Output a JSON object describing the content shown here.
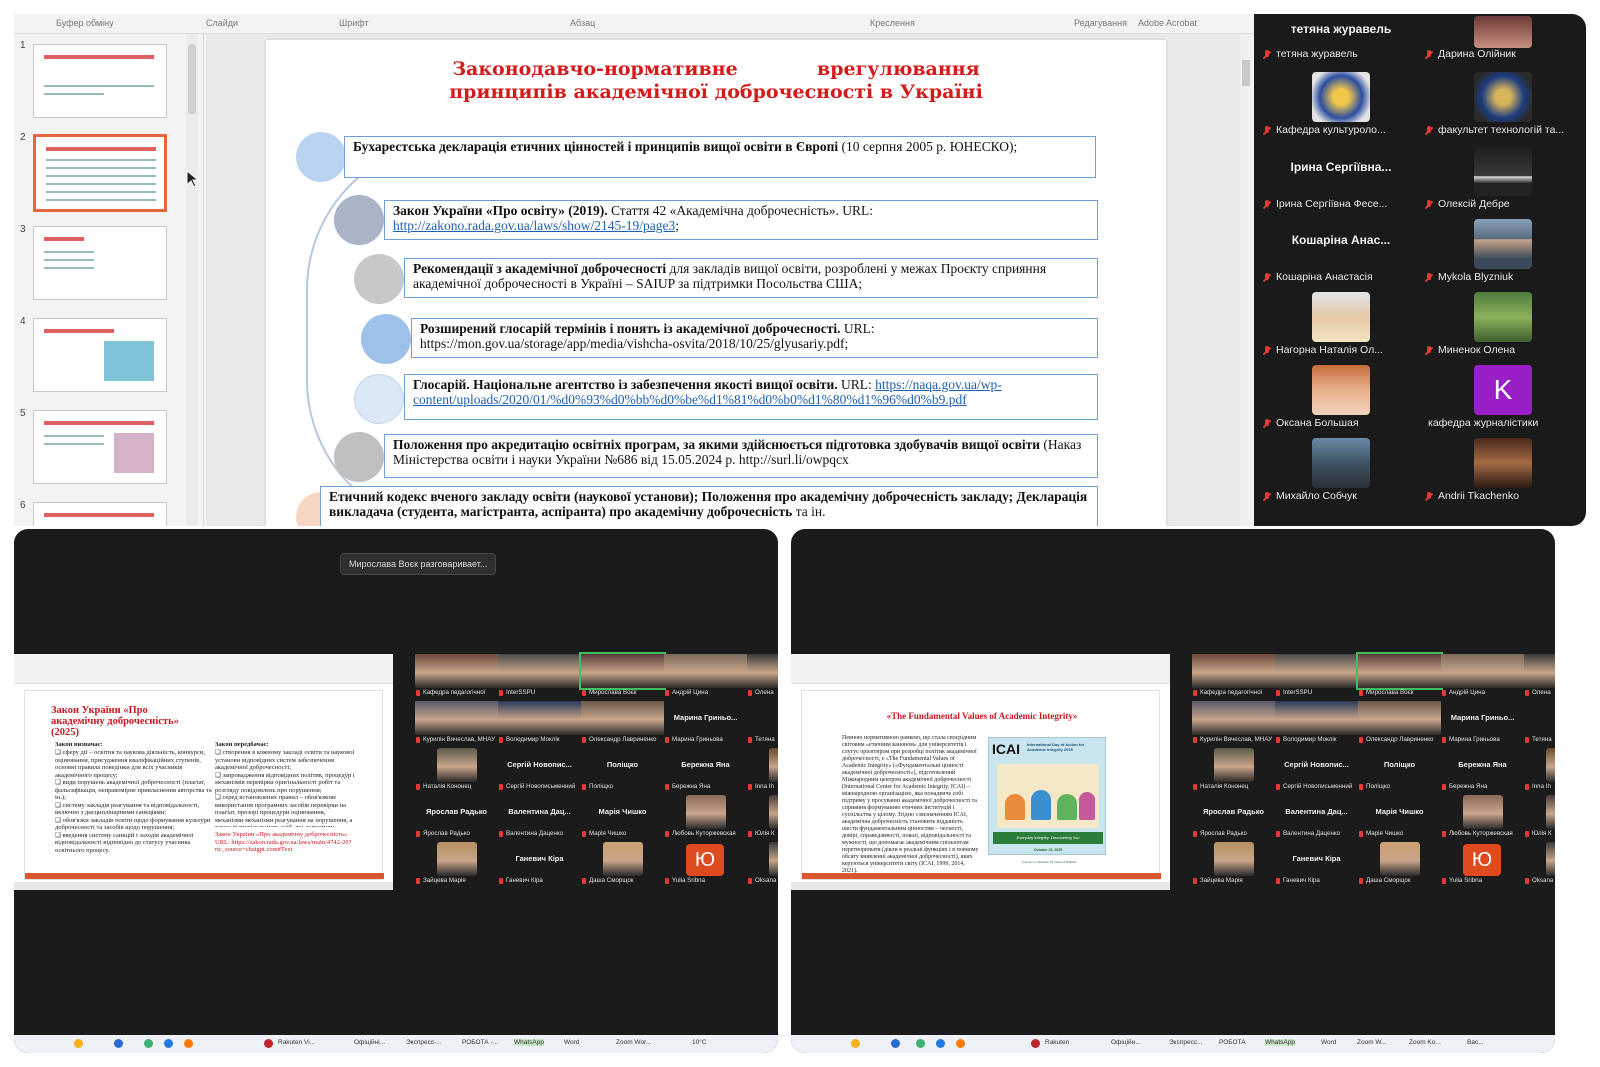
{
  "top": {
    "ribbon": [
      "Буфер обміну",
      "Слайди",
      "Шрифт",
      "Абзац",
      "Креслення",
      "Редагування",
      "Adobe Acrobat"
    ],
    "thumbnails": [
      "1",
      "2",
      "3",
      "4",
      "5",
      "6"
    ],
    "slide": {
      "title_line1": "Законодавчо-нормативне            врегулювання",
      "title_line2": "принципів академічної доброчесності в Україні",
      "items": [
        {
          "bold": "Бухарестська декларація етичних цінностей і принципів вищої освіти в Європі",
          "text": " (10 серпня 2005 р. ЮНЕСКО);",
          "url": ""
        },
        {
          "bold": "Закон України «Про освіту» (2019).",
          "text": " Стаття 42 «Академічна доброчесність». URL: ",
          "url": "http://zakono.rada.gov.ua/laws/show/2145-19/page3",
          "tail": ";"
        },
        {
          "bold": "Рекомендації з академічної доброчесності",
          "text": " для закладів вищої освіти, розроблені у межах Проєкту сприяння академічної доброчесності в Україні – SAIUP за підтримки Посольства США;",
          "url": ""
        },
        {
          "bold": "Розширений глосарій термінів і понять із академічної доброчесності.",
          "text": " URL: https://mon.gov.ua/storage/app/media/vishcha-osvita/2018/10/25/glyusariy.pdf;",
          "url": ""
        },
        {
          "bold": "Глосарій. Національне агентство із забезпечення якості вищої освіти.",
          "text": " URL: ",
          "url": "https://naqa.gov.ua/wp-content/uploads/2020/01/%d0%93%d0%bb%d0%be%d1%81%d0%b0%d1%80%d1%96%d0%b9.pdf"
        },
        {
          "bold": "Положення про акредитацію освітніх програм, за якими здійснюється підготовка здобувачів вищої освіти",
          "text": " (Наказ Міністерства освіти і науки України №686 від 15.05.2024 р. http://surl.li/owpqcx",
          "url": ""
        },
        {
          "bold": "Етичний кодекс вченого закладу освіти (наукової установи); Положення про академічну доброчесність закладу; Декларація викладача (студента, магістранта, аспіранта) про академічну доброчесність",
          "text": " та ін.",
          "url": ""
        }
      ]
    },
    "gallery": [
      {
        "big": "тетяна журавель",
        "name": "тетяна журавель"
      },
      {
        "big": "",
        "name": "Дарина Олійник"
      },
      {
        "big": "",
        "name": "Кафедра культуроло..."
      },
      {
        "big": "",
        "name": "факультет технологій та..."
      },
      {
        "big": "Ірина Сергіївна...",
        "name": "Ірина Сергіївна Фесе..."
      },
      {
        "big": "",
        "name": "Олексій Дебре"
      },
      {
        "big": "Кошаріна Анас...",
        "name": "Кошаріна Анастасія"
      },
      {
        "big": "",
        "name": "Mykola Blyzniuk"
      },
      {
        "big": "",
        "name": "Нагорна Наталія Ол..."
      },
      {
        "big": "",
        "name": "Миненок Олена"
      },
      {
        "big": "",
        "name": "Оксана Большая"
      },
      {
        "big": "K",
        "name": "кафедра журналістики"
      },
      {
        "big": "",
        "name": "Михайло Собчук"
      },
      {
        "big": "",
        "name": "Andrii Tkachenko"
      }
    ]
  },
  "bottom_left": {
    "tooltip": "Мирослава Воєк разговаривает...",
    "slide": {
      "title": "Закон України «Про академічну доброчесність» (2025)",
      "col1_head": "Закон визначає:",
      "col1": "❑ сферу дії – освітня та наукова діяльність, конкурси, оцінювання, присудження кваліфікаційних ступенів, основні правила поведінки для всіх учасників академічного процесу;\n❑ види порушень академічної доброчесності (плагіат, фальсифікація, неправомірне привласнення авторства та ін.);\n❑ систему закладів реагування та відповідальності, включно з дисциплінарними санкціями;\n❑ обов'язки закладів освіти щодо формування культури доброчесності та засобів щодо порушення;\n❑ введення систему санкцій і заходів академічної відповідальності відповідно до статусу учасника освітнього процесу.",
      "col2_head": "Закон передбачає:",
      "col2": "❑ створення в кожному закладі освіти та наукової установи відповідних систем забезпечення академічної доброчесності;\n❑ запровадження відповідних політик, процедур і механізмів перевірки оригінальності робіт та розгляду повідомлень про порушення;\n❑ серед встановлених правил – обов'язкове використання програмних засобів перевірки на плагіат, прозорі процедури оцінювання, механізми механізми реагування на порушення, а також відповідальність осіб, які допустили порушення академічної доброчесності.",
      "link": "Закон України «Про академічну доброчесність» URL: https://zakon.rada.gov.ua/laws/main/4742-20?rtc_source=chatgpt.com#Text"
    }
  },
  "bottom_right": {
    "slide": {
      "title": "«The Fundamental Values of Academic Integrity»",
      "body": "Певною нормативною рамкою, що стала своєрідним світовим «етичним каноном» для університетів і слугує орієнтиром при розробці політик академічної доброчесності, є «The Fundamental Values of Academic Integrity» («Фундаментальні цінності академічної доброчесності»), підготовлений Міжнародним центром академічної доброчесності (International Center for Academic Integrity, ICAI) – міжнародною організацією, яка понадвиче собі підтриму у просуванні академічної доброчесності та сприяння формуванню етичних інституцій і суспільства у цілому. Згідно з визначенням ICAI, академічна доброчесність становить відданість шести фундаментальним цінностям – чесності, довірі, справедливості, повазі, відповідальності та мужності, що допомагає академічним спільнотам перетворювати (діяли в реальні функціях і в повному обсягу виявленні академічної доброчесності), яких керуються університети світу (ICAI, 1999, 2014, 2021).",
      "icai_logo": "ICAI",
      "icai_head": "International Day of Action for Academic Integrity 2025",
      "icai_foot": "Everyday Integrity: Discovering You",
      "icai_date": "October 15, 2025",
      "icai_foot2": "Join us to celebrate 25 years of IDOAI"
    }
  },
  "bottom_gallery": [
    {
      "big": "",
      "name": "Кафедра педагогічної"
    },
    {
      "big": "",
      "name": "InterSSPU"
    },
    {
      "big": "",
      "name": "Мирослава Воєк"
    },
    {
      "big": "",
      "name": "Андрій Цина"
    },
    {
      "big": "",
      "name": "Олена"
    },
    {
      "big": "",
      "name": "Курилін Вячеслав, МНАУ"
    },
    {
      "big": "",
      "name": "Володимир Моклік"
    },
    {
      "big": "",
      "name": "Олександр Лавриненко"
    },
    {
      "big": "Марина Гриньо...",
      "name": "Марина Гриньова"
    },
    {
      "big": "Тетян",
      "name": "Тетяна"
    },
    {
      "big": "",
      "name": "Наталія Кононец"
    },
    {
      "big": "Сергій Новопис...",
      "name": "Сергій Новописьменний"
    },
    {
      "big": "Поліщко",
      "name": "Поліщко"
    },
    {
      "big": "Бережна Яна",
      "name": "Бережна Яна"
    },
    {
      "big": "",
      "name": "Inna Ih"
    },
    {
      "big": "Ярослав Радько",
      "name": "Ярослав Радько"
    },
    {
      "big": "Валентина Дац...",
      "name": "Валентина Даценко"
    },
    {
      "big": "Марія Чишко",
      "name": "Марія Чишко"
    },
    {
      "big": "",
      "name": "Любовь Куторжевская"
    },
    {
      "big": "",
      "name": "Юлія К"
    },
    {
      "big": "",
      "name": "Зайцева Марія"
    },
    {
      "big": "Ганевич Кіра",
      "name": "Ганевич Кіра"
    },
    {
      "big": "",
      "name": "Даша Сморщок"
    },
    {
      "big": "Ю",
      "name": "Yulia Sribna"
    },
    {
      "big": "",
      "name": "Oksana"
    }
  ],
  "taskbar_left": [
    "Rakuten Vi...",
    "Офіційні...",
    "Экспресс-...",
    "РОБОТА -...",
    "WhatsApp",
    "Word",
    "Zoom Wor...",
    "10°C"
  ],
  "taskbar_right": [
    "Rakuten",
    "Офіційн...",
    "Экспресс...",
    "РОБОТА",
    "WhatsApp",
    "Word",
    "Zoom W...",
    "Zoom Ko...",
    "Вас..."
  ],
  "colors": {
    "slide_title": "#d31b1b",
    "box_border": "#6f9fd0",
    "zoom_bg": "#1a1a1a",
    "active_speaker": "#3fbf5f"
  }
}
